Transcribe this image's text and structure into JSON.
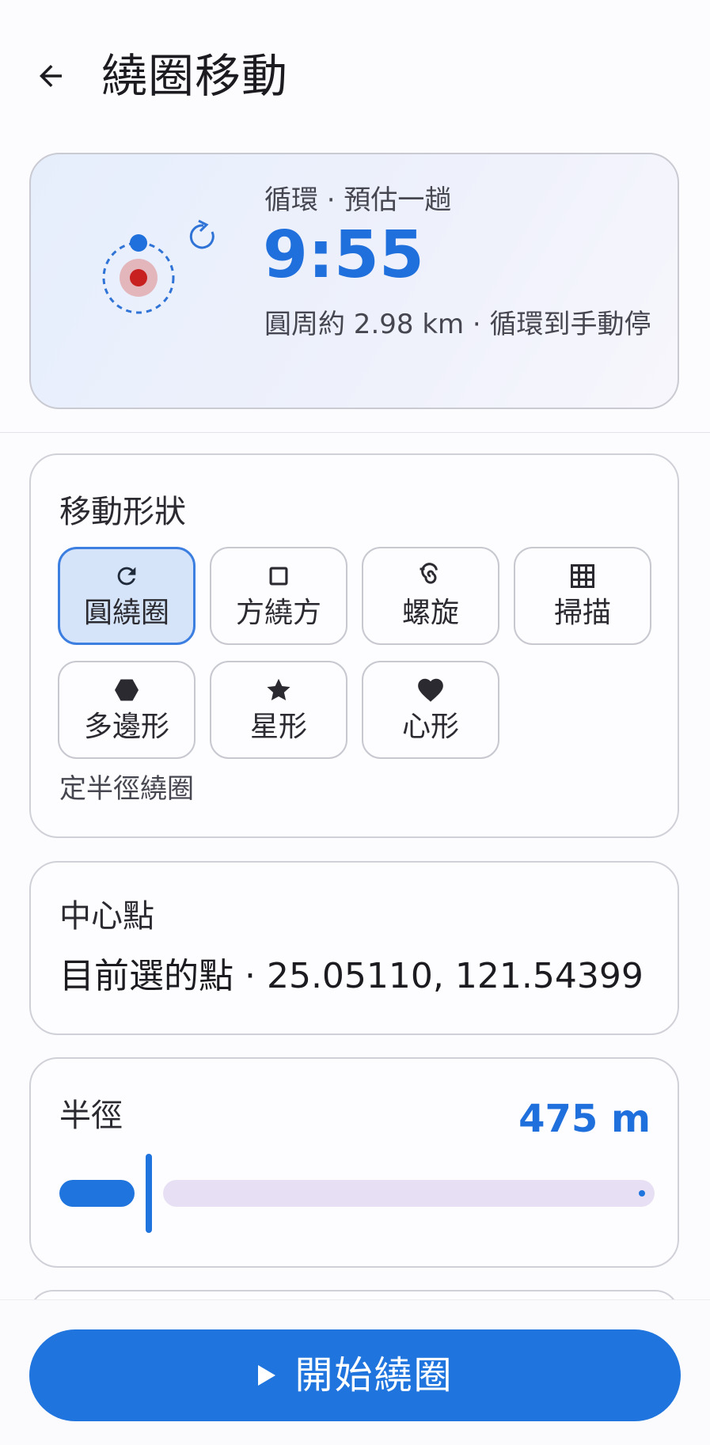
{
  "header": {
    "title": "繞圈移動",
    "back_icon": "arrow-left-icon"
  },
  "summary": {
    "mode_label": "循環 · 預估一趟",
    "estimate_time": "9:55",
    "detail": "圓周約 2.98 km · 循環到手動停",
    "accent_color": "#1f6fdc"
  },
  "shape_section": {
    "title": "移動形狀",
    "options": [
      {
        "label": "圓繞圈",
        "icon": "refresh-icon",
        "selected": true
      },
      {
        "label": "方繞方",
        "icon": "square-icon",
        "selected": false
      },
      {
        "label": "螺旋",
        "icon": "spiral-icon",
        "selected": false
      },
      {
        "label": "掃描",
        "icon": "grid-icon",
        "selected": false
      },
      {
        "label": "多邊形",
        "icon": "hexagon-icon",
        "selected": false
      },
      {
        "label": "星形",
        "icon": "star-icon",
        "selected": false
      },
      {
        "label": "心形",
        "icon": "heart-icon",
        "selected": false
      }
    ],
    "description": "定半徑繞圈"
  },
  "center_section": {
    "title": "中心點",
    "value": "目前選的點 · 25.05110, 121.54399"
  },
  "radius_section": {
    "title": "半徑",
    "value": "475 m",
    "slider_fraction": 0.15
  },
  "actions": {
    "start_label": "開始繞圈",
    "start_icon": "play-icon"
  }
}
